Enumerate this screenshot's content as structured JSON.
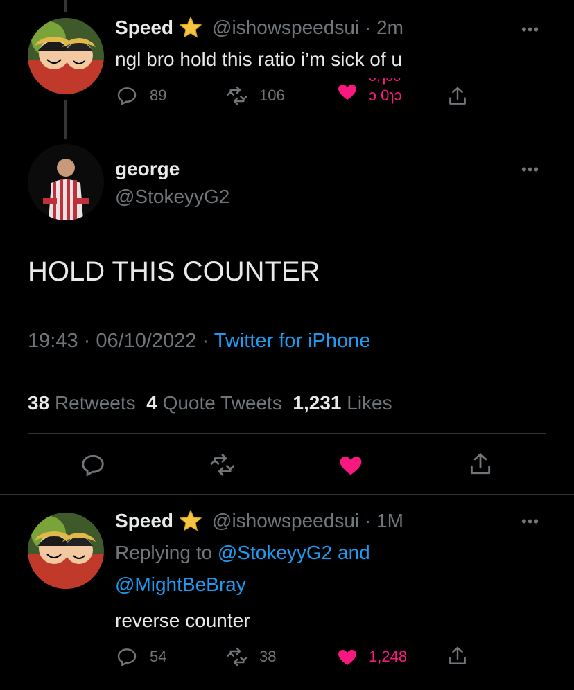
{
  "colors": {
    "background": "#000000",
    "text": "#e7e9ea",
    "muted": "#71767b",
    "link": "#1d9bf0",
    "like": "#f91880",
    "divider": "#2f3336"
  },
  "tweet1": {
    "name": "Speed",
    "handle_time": "@ishowspeedsui · 2m",
    "text": "ngl bro hold this ratio i’m sick of u",
    "replies": "89",
    "retweets": "106",
    "likes_partial_top": "ɔ,ɿɔɔ",
    "likes_partial_bottom": "ɔ 0ɿɔ"
  },
  "main": {
    "name": "george",
    "handle": "@StokeyyG2",
    "text": "HOLD THIS COUNTER",
    "time": "19:43 · 06/10/2022 · ",
    "source": "Twitter for iPhone",
    "retweets_num": "38",
    "retweets_label": "Retweets",
    "quotes_num": "4",
    "quotes_label": "Quote Tweets",
    "likes_num": "1,231",
    "likes_label": "Likes"
  },
  "tweet2": {
    "name": "Speed",
    "handle_time": "@ishowspeedsui · 1M",
    "replying_prefix": "Replying to ",
    "replying_users_line1": "@StokeyyG2 and",
    "replying_users_line2": "@MightBeBray",
    "text": "reverse counter",
    "replies": "54",
    "retweets": "38",
    "likes": "1,248"
  },
  "icons": [
    "star-icon",
    "reply-icon",
    "retweet-icon",
    "like-icon",
    "share-icon",
    "more-icon"
  ]
}
